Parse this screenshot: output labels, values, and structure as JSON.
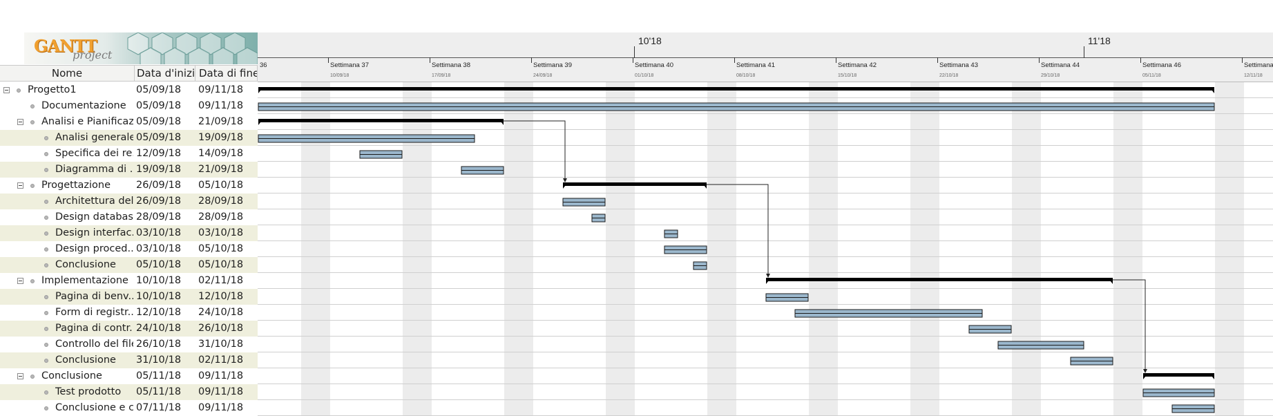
{
  "logo": {
    "gantt": "GANTT",
    "project": "project"
  },
  "table": {
    "headers": {
      "name": "Nome",
      "start": "Data d'inizio",
      "end": "Data di fine"
    },
    "rows": [
      {
        "name": "Progetto1",
        "start": "05/09/18",
        "end": "09/11/18",
        "level": 0,
        "group": true
      },
      {
        "name": "Documentazione",
        "start": "05/09/18",
        "end": "09/11/18",
        "level": 1,
        "group": false
      },
      {
        "name": "Analisi e Pianificaz...",
        "start": "05/09/18",
        "end": "21/09/18",
        "level": 1,
        "group": true
      },
      {
        "name": "Analisi generale",
        "start": "05/09/18",
        "end": "19/09/18",
        "level": 2,
        "group": false
      },
      {
        "name": "Specifica dei re...",
        "start": "12/09/18",
        "end": "14/09/18",
        "level": 2,
        "group": false
      },
      {
        "name": "Diagramma di ...",
        "start": "19/09/18",
        "end": "21/09/18",
        "level": 2,
        "group": false
      },
      {
        "name": "Progettazione",
        "start": "26/09/18",
        "end": "05/10/18",
        "level": 1,
        "group": true
      },
      {
        "name": "Architettura del...",
        "start": "26/09/18",
        "end": "28/09/18",
        "level": 2,
        "group": false
      },
      {
        "name": "Design database",
        "start": "28/09/18",
        "end": "28/09/18",
        "level": 2,
        "group": false
      },
      {
        "name": "Design interfac...",
        "start": "03/10/18",
        "end": "03/10/18",
        "level": 2,
        "group": false
      },
      {
        "name": "Design proced...",
        "start": "03/10/18",
        "end": "05/10/18",
        "level": 2,
        "group": false
      },
      {
        "name": "Conclusione",
        "start": "05/10/18",
        "end": "05/10/18",
        "level": 2,
        "group": false
      },
      {
        "name": "Implementazione",
        "start": "10/10/18",
        "end": "02/11/18",
        "level": 1,
        "group": true
      },
      {
        "name": "Pagina di benv...",
        "start": "10/10/18",
        "end": "12/10/18",
        "level": 2,
        "group": false
      },
      {
        "name": "Form di registr...",
        "start": "12/10/18",
        "end": "24/10/18",
        "level": 2,
        "group": false
      },
      {
        "name": "Pagina di contr...",
        "start": "24/10/18",
        "end": "26/10/18",
        "level": 2,
        "group": false
      },
      {
        "name": "Controllo del file",
        "start": "26/10/18",
        "end": "31/10/18",
        "level": 2,
        "group": false
      },
      {
        "name": "Conclusione",
        "start": "31/10/18",
        "end": "02/11/18",
        "level": 2,
        "group": false
      },
      {
        "name": "Conclusione",
        "start": "05/11/18",
        "end": "09/11/18",
        "level": 1,
        "group": true
      },
      {
        "name": "Test prodotto",
        "start": "05/11/18",
        "end": "09/11/18",
        "level": 2,
        "group": false
      },
      {
        "name": "Conclusione e c...",
        "start": "07/11/18",
        "end": "09/11/18",
        "level": 2,
        "group": false
      }
    ]
  },
  "timeline": {
    "months": [
      "10'18",
      "11'18"
    ],
    "weeks": [
      {
        "label": "36",
        "date": ""
      },
      {
        "label": "Settimana  37",
        "date": "10/09/18"
      },
      {
        "label": "Settimana  38",
        "date": "17/09/18"
      },
      {
        "label": "Settimana  39",
        "date": "24/09/18"
      },
      {
        "label": "Settimana  40",
        "date": "01/10/18"
      },
      {
        "label": "Settimana  41",
        "date": "08/10/18"
      },
      {
        "label": "Settimana  42",
        "date": "15/10/18"
      },
      {
        "label": "Settimana  43",
        "date": "22/10/18"
      },
      {
        "label": "Settimana  44",
        "date": "29/10/18"
      },
      {
        "label": "Settimana  46",
        "date": "05/11/18"
      },
      {
        "label": "Settimana",
        "date": "12/11/18"
      }
    ]
  },
  "colors": {
    "task_bar": "#9bb7cc",
    "task_bar_border": "#1a1a1a",
    "summary_bar": "#000000",
    "weekend": "#ececec",
    "row_alt": "#efefdd"
  }
}
